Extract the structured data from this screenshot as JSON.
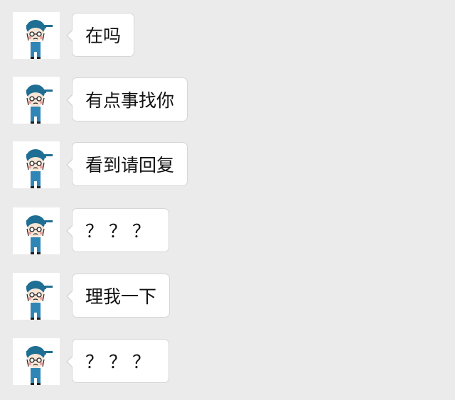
{
  "chat": {
    "messages": [
      {
        "text": "在吗",
        "avatar_icon": "cartoon-boy-avatar-icon"
      },
      {
        "text": "有点事找你",
        "avatar_icon": "cartoon-boy-avatar-icon"
      },
      {
        "text": "看到请回复",
        "avatar_icon": "cartoon-boy-avatar-icon"
      },
      {
        "text": "？？？",
        "avatar_icon": "cartoon-boy-avatar-icon"
      },
      {
        "text": "理我一下",
        "avatar_icon": "cartoon-boy-avatar-icon"
      },
      {
        "text": "？？？",
        "avatar_icon": "cartoon-boy-avatar-icon"
      }
    ]
  },
  "colors": {
    "background": "#ebebeb",
    "bubble": "#ffffff",
    "bubble_border": "#d6d6d6",
    "avatar_cap": "#1f6e93",
    "avatar_overalls": "#2f86b6"
  }
}
